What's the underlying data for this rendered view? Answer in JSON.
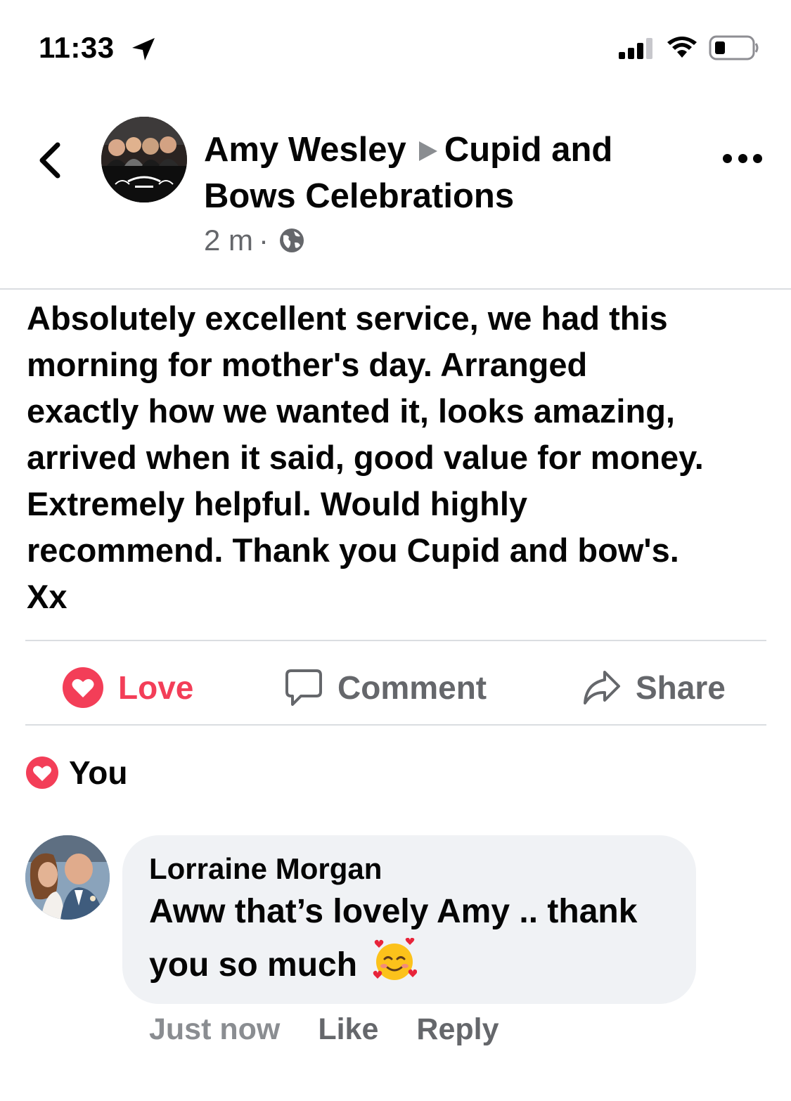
{
  "status_bar": {
    "time": "11:33",
    "icons": [
      "location-arrow-icon",
      "cellular-signal-icon",
      "wifi-icon",
      "battery-icon"
    ]
  },
  "post": {
    "author": "Amy Wesley",
    "target": "Cupid and Bows Celebrations",
    "time": "2 m",
    "separator": "·",
    "privacy_icon": "globe-icon",
    "body": "Absolutely excellent service, we had this\nmorning for mother's day. Arranged\nexactly how we wanted it, looks amazing,\narrived when it said, good value for money.\nExtremely helpful. Would highly\nrecommend. Thank you Cupid and bow's.\nXx"
  },
  "actions": {
    "love": "Love",
    "comment": "Comment",
    "share": "Share"
  },
  "reactions": {
    "label": "You"
  },
  "comment": {
    "author": "Lorraine Morgan",
    "text": "Aww that’s lovely Amy .. thank you so much",
    "emoji": "smiling-face-with-hearts-icon",
    "time": "Just now",
    "like": "Like",
    "reply": "Reply"
  },
  "colors": {
    "love_red": "#f33e58",
    "secondary_text": "#65676b",
    "bubble_bg": "#f0f2f5",
    "divider": "#dadde1"
  }
}
